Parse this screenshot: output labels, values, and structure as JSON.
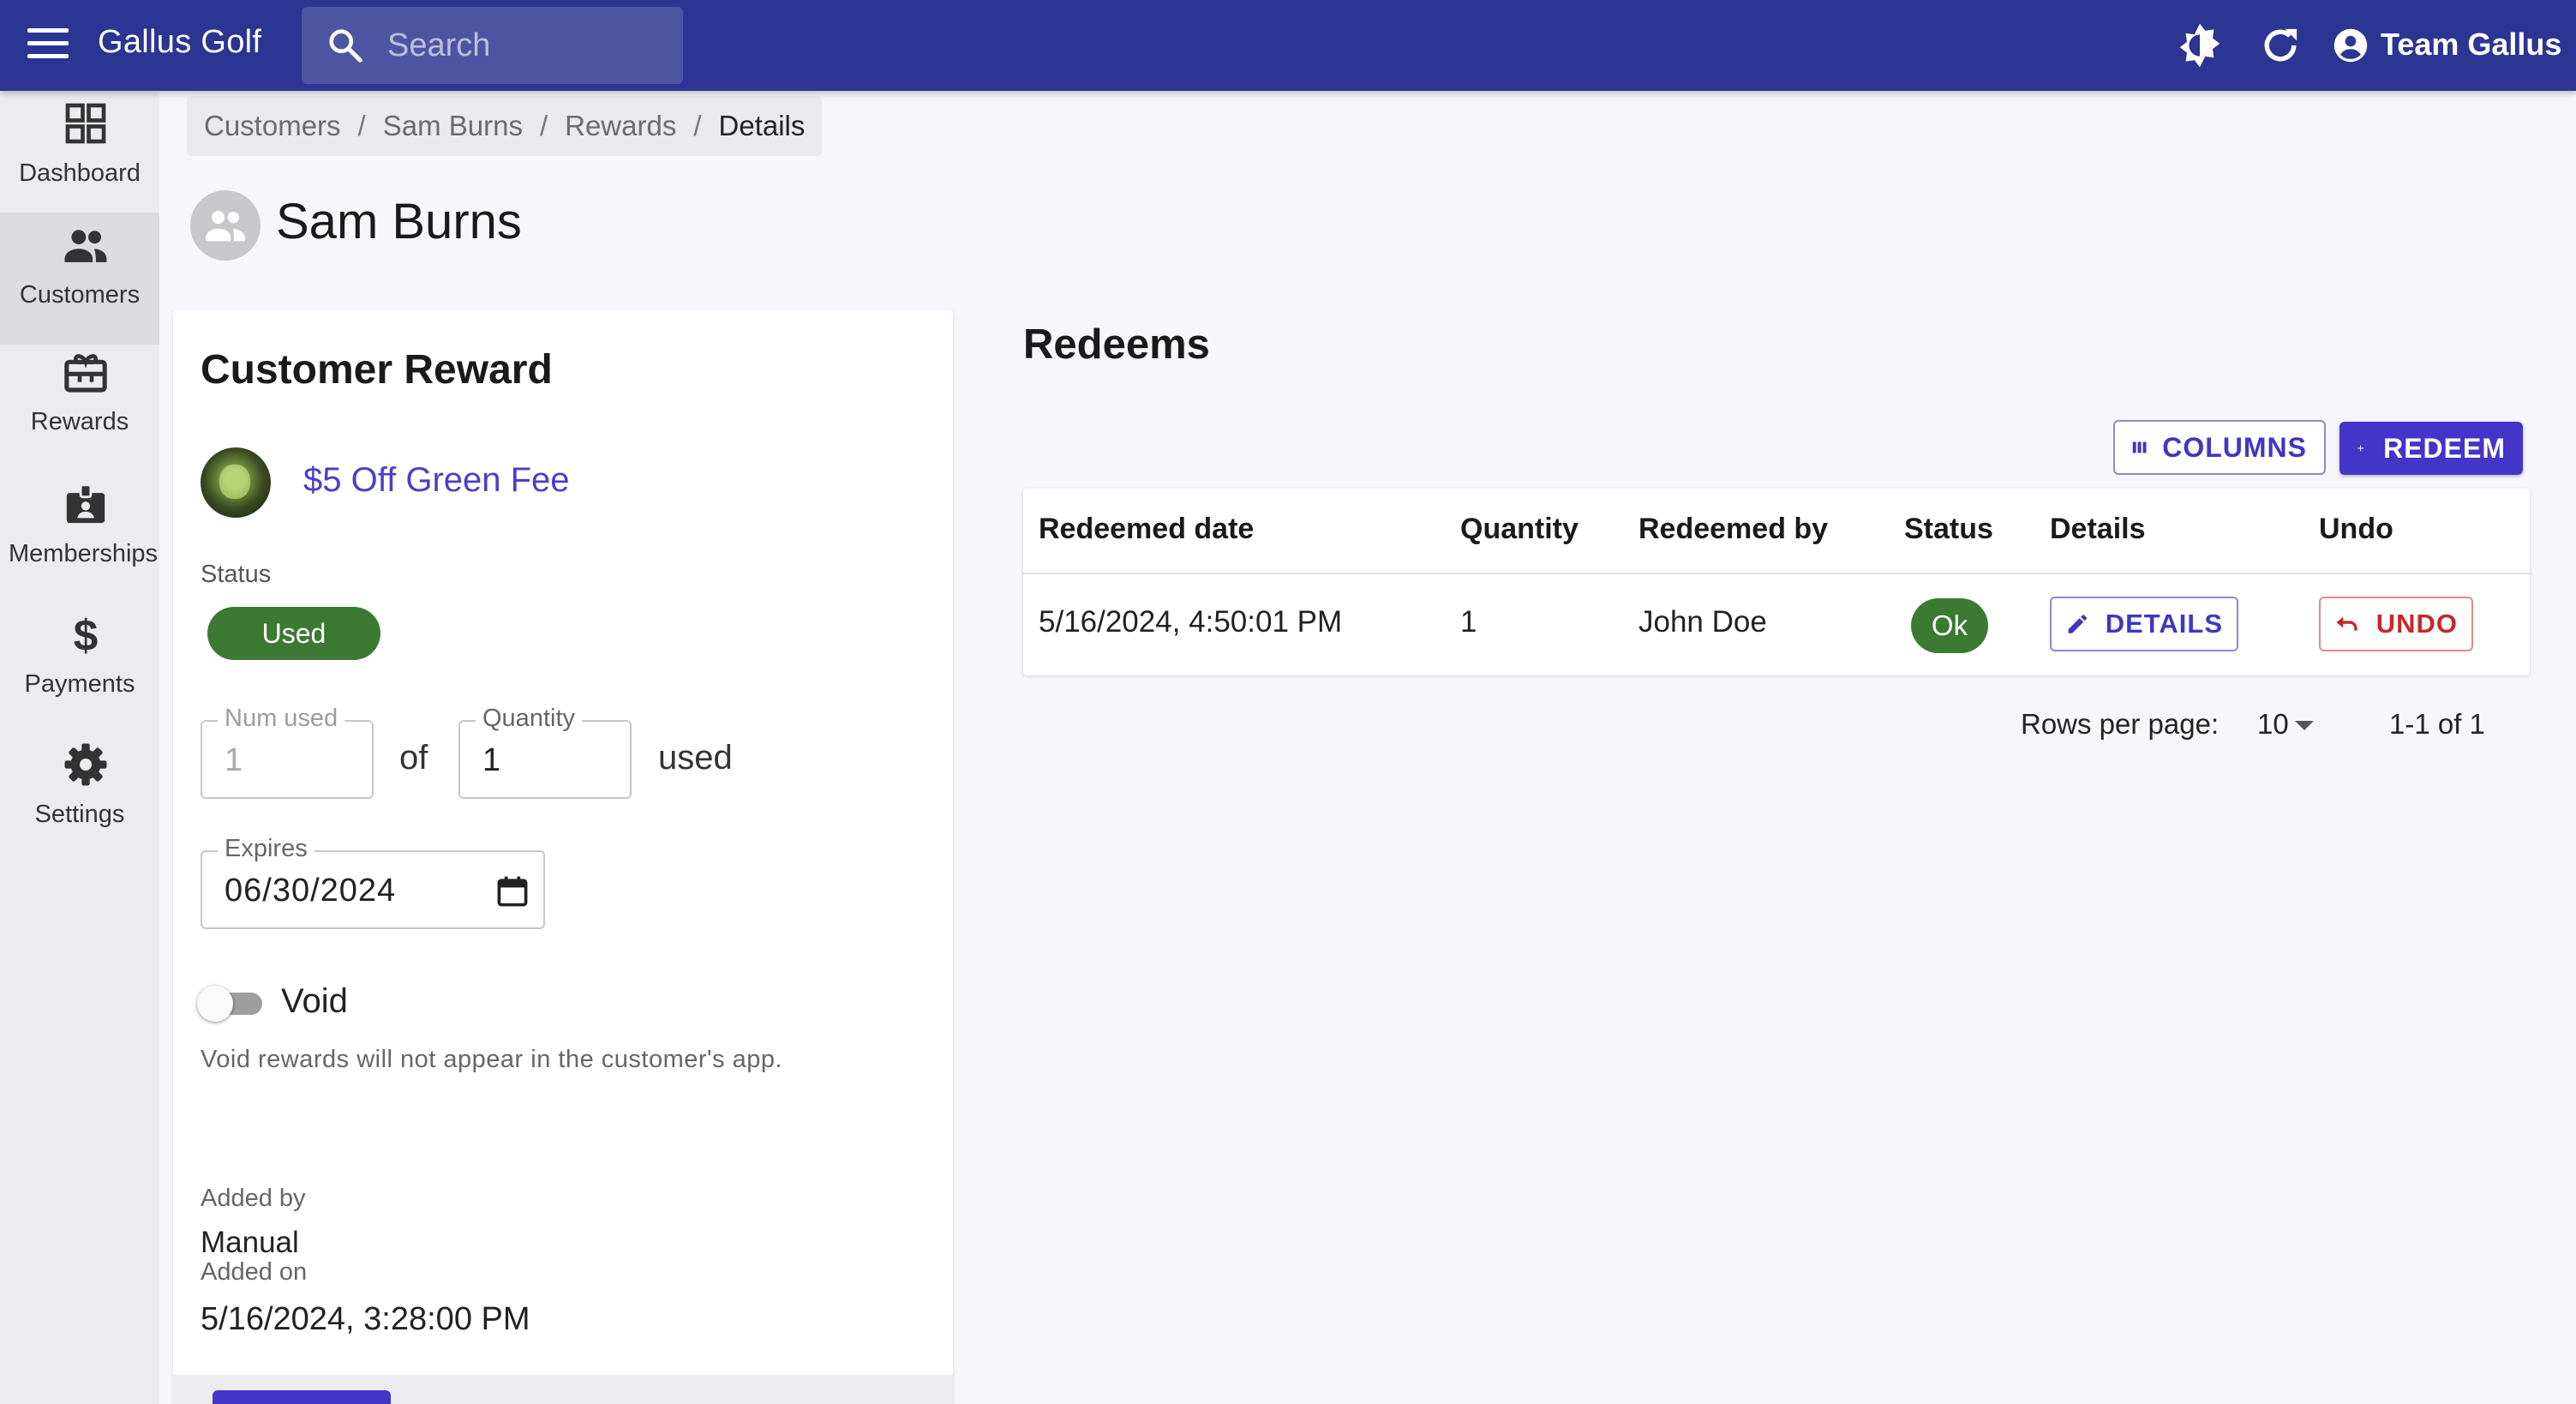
{
  "appbar": {
    "title": "Gallus Golf",
    "search_placeholder": "Search",
    "account_label": "Team Gallus"
  },
  "sidebar": {
    "items": [
      {
        "label": "Dashboard",
        "icon": "dashboard-icon"
      },
      {
        "label": "Customers",
        "icon": "people-icon",
        "active": true
      },
      {
        "label": "Rewards",
        "icon": "gift-icon"
      },
      {
        "label": "Memberships",
        "icon": "badge-icon"
      },
      {
        "label": "Payments",
        "icon": "dollar-icon"
      },
      {
        "label": "Settings",
        "icon": "gear-icon"
      }
    ]
  },
  "breadcrumb": [
    "Customers",
    "Sam Burns",
    "Rewards",
    "Details"
  ],
  "page": {
    "title": "Sam Burns"
  },
  "reward_card": {
    "title": "Customer Reward",
    "reward_name": "$5 Off Green Fee",
    "status_label": "Status",
    "status_value": "Used",
    "num_used_label": "Num used",
    "num_used_value": "1",
    "of_text": "of",
    "quantity_label": "Quantity",
    "quantity_value": "1",
    "used_text": "used",
    "expires_label": "Expires",
    "expires_value": "06/30/2024",
    "void_label": "Void",
    "void_help": "Void rewards will not appear in the customer's app.",
    "added_by_label": "Added by",
    "added_by_value": "Manual",
    "added_on_label": "Added on",
    "added_on_value": "5/16/2024, 3:28:00 PM"
  },
  "redeems": {
    "title": "Redeems",
    "columns_button": "COLUMNS",
    "redeem_button": "REDEEM",
    "headers": [
      "Redeemed date",
      "Quantity",
      "Redeemed by",
      "Status",
      "Details",
      "Undo"
    ],
    "rows": [
      {
        "date": "5/16/2024, 4:50:01 PM",
        "quantity": "1",
        "redeemed_by": "John Doe",
        "status": "Ok",
        "details_button": "DETAILS",
        "undo_button": "UNDO"
      }
    ],
    "rows_per_page_label": "Rows per page:",
    "rows_per_page_value": "10",
    "page_range": "1-1 of 1"
  },
  "colors": {
    "appbar": "#2c3592",
    "primary": "#4434c8",
    "success": "#3c7a34",
    "danger": "#c62828"
  }
}
